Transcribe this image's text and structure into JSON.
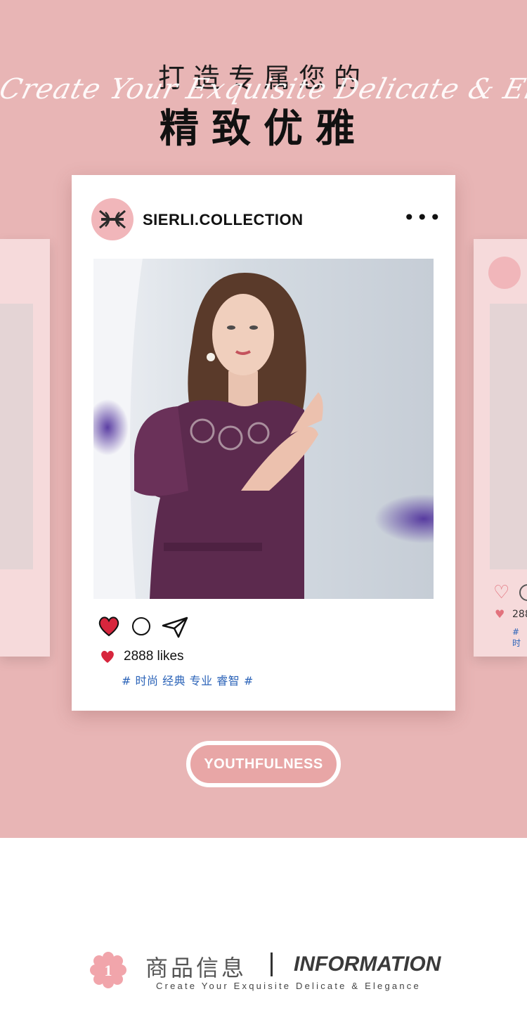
{
  "hero": {
    "title_line1": "打造专属您的",
    "script_text": "Create Your Exquisite Delicate & Elegance",
    "title_line2": "精致优雅",
    "background_color": "#e8b5b5"
  },
  "post": {
    "account_name": "SIERLI.COLLECTION",
    "more_icon": "•••",
    "likes_text": "2888 likes",
    "tags": "# 时尚 经典 专业 睿智 #",
    "heart_color": "#d7263d",
    "tag_color": "#2b63b8"
  },
  "side_card_right": {
    "likes_partial": "288",
    "tags_partial": "# 时"
  },
  "cta": {
    "label": "YOUTHFULNESS"
  },
  "section": {
    "number": "1",
    "title_cn": "商品信息",
    "title_en": "INFORMATION",
    "subtitle": "Create Your Exquisite Delicate & Elegance"
  }
}
